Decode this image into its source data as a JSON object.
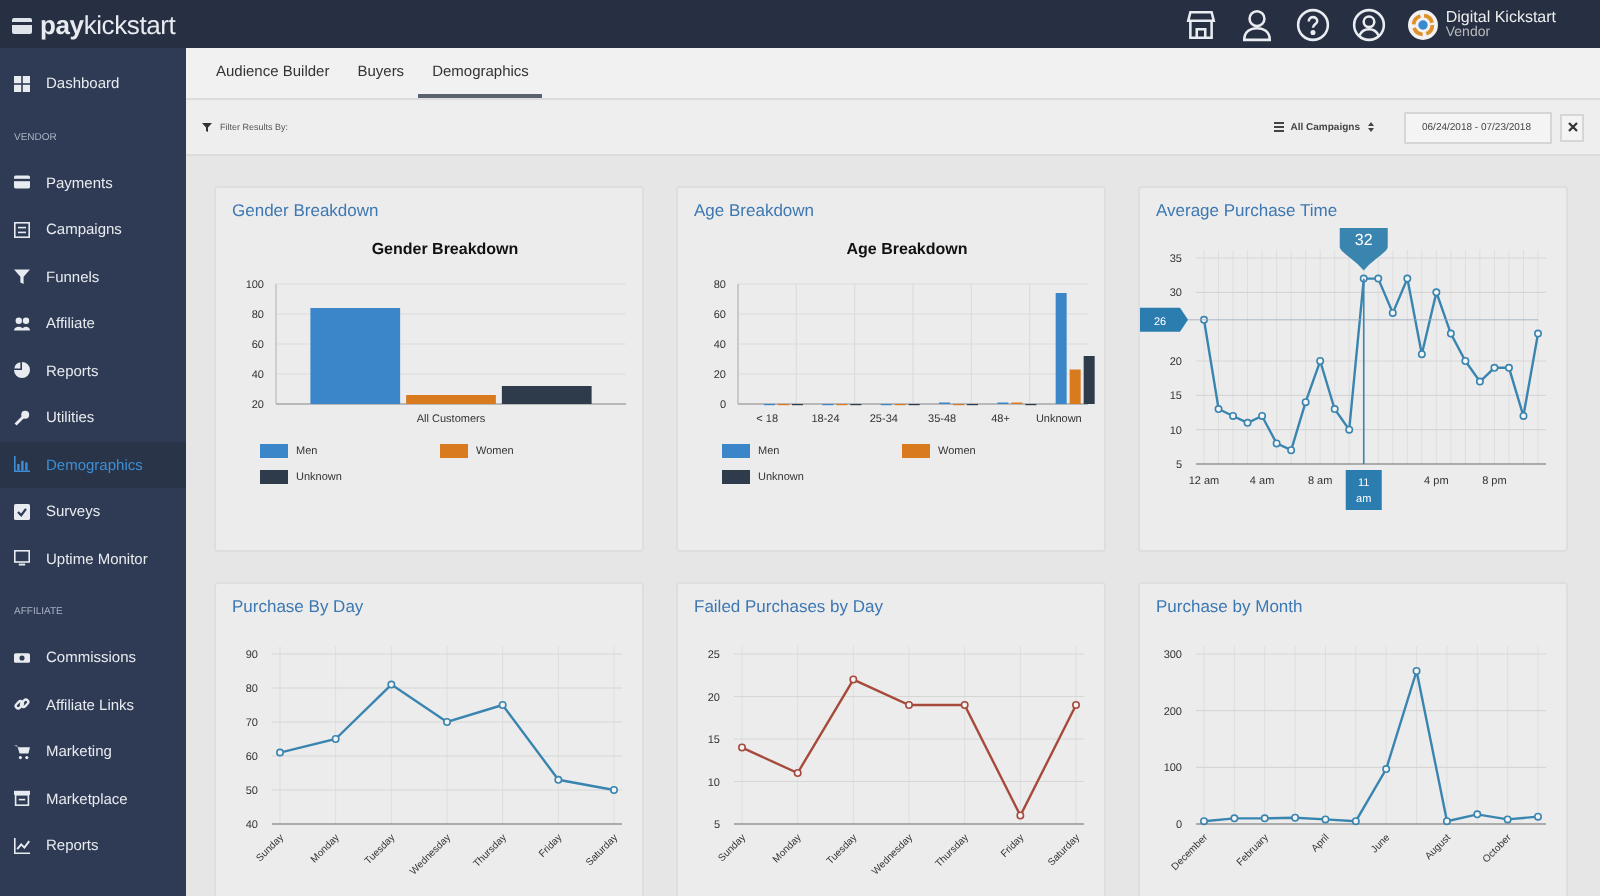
{
  "top_bar": {
    "logo": "**pay**kickstart",
    "account": {
      "name": "Digital Kickstart",
      "role": "Vendor"
    }
  },
  "sidebar": {
    "sections": [
      {
        "items": [
          {
            "label": "Dashboard",
            "selected": false
          }
        ]
      },
      {
        "heading": "VENDOR",
        "items": [
          {
            "label": "Payments",
            "selected": false
          },
          {
            "label": "Campaigns",
            "selected": false
          },
          {
            "label": "Funnels",
            "selected": false
          },
          {
            "label": "Affiliate",
            "selected": false
          },
          {
            "label": "Reports",
            "selected": false
          },
          {
            "label": "Utilities",
            "selected": false
          },
          {
            "label": "Demographics",
            "selected": true
          },
          {
            "label": "Surveys",
            "selected": false
          },
          {
            "label": "Uptime Monitor",
            "selected": false
          }
        ]
      },
      {
        "heading": "AFFILIATE",
        "items": [
          {
            "label": "Commissions",
            "selected": false
          },
          {
            "label": "Affiliate Links",
            "selected": false
          },
          {
            "label": "Marketing",
            "selected": false
          },
          {
            "label": "Marketplace",
            "selected": false
          },
          {
            "label": "Reports",
            "selected": false
          }
        ]
      }
    ]
  },
  "tabs": [
    {
      "label": "Audience Builder",
      "selected": false
    },
    {
      "label": "Buyers",
      "selected": false
    },
    {
      "label": "Demographics",
      "selected": true
    }
  ],
  "filter_bar": {
    "label": "Filter Results By:",
    "campaigns": "All Campaigns",
    "date_range": "06/24/2018 - 07/23/2018"
  },
  "cards": [
    {
      "title": "Gender Breakdown",
      "chart_data": {
        "type": "bar",
        "title": "Gender Breakdown",
        "grid": true,
        "categories": [
          "All Customers"
        ],
        "yticks": [
          20,
          40,
          60,
          80,
          100
        ],
        "ylim": [
          20,
          100
        ],
        "series": [
          {
            "name": "Men",
            "color": "#3b86c8",
            "values": [
              84
            ]
          },
          {
            "name": "Women",
            "color": "#d97a1e",
            "values": [
              26
            ]
          },
          {
            "name": "Unknown",
            "color": "#2d3b4a",
            "values": [
              32
            ]
          }
        ]
      }
    },
    {
      "title": "Age Breakdown",
      "chart_data": {
        "type": "bar",
        "title": "Age Breakdown",
        "grid": true,
        "categories": [
          "< 18",
          "18-24",
          "25-34",
          "35-48",
          "48+",
          "Unknown"
        ],
        "yticks": [
          0,
          20,
          40,
          60,
          80
        ],
        "ylim": [
          0,
          80
        ],
        "series": [
          {
            "name": "Men",
            "color": "#3b86c8",
            "values": [
              0,
              0,
              0,
              1,
              1,
              74
            ]
          },
          {
            "name": "Women",
            "color": "#d97a1e",
            "values": [
              0,
              0,
              0,
              0,
              1,
              23
            ]
          },
          {
            "name": "Unknown",
            "color": "#2d3b4a",
            "values": [
              0,
              0,
              0,
              0,
              0,
              32
            ]
          }
        ]
      }
    },
    {
      "title": "Average Purchase Time",
      "chart_data": {
        "type": "line",
        "grid": true,
        "categories": [
          "12 am",
          null,
          null,
          null,
          "4 am",
          null,
          null,
          null,
          "8 am",
          null,
          null,
          null,
          null,
          null,
          null,
          null,
          "4 pm",
          null,
          null,
          null,
          "8 pm",
          null,
          null,
          null
        ],
        "ylim": [
          5,
          35
        ],
        "yticks": [
          5,
          10,
          15,
          20,
          30,
          35
        ],
        "series": [
          {
            "color": "#3a85b0",
            "marker": "o",
            "values": [
              26,
              13,
              12,
              11,
              12,
              8,
              7,
              14,
              20,
              13,
              10,
              32,
              32,
              27,
              32,
              21,
              30,
              24,
              20,
              17,
              19,
              19,
              12,
              24
            ]
          }
        ],
        "annotations": [
          {
            "text": "32",
            "y": 32
          },
          {
            "text": "11 am"
          }
        ],
        "ref_lines": [
          {
            "axis": "y",
            "value": 26,
            "label": "26"
          }
        ]
      }
    },
    {
      "title": "Purchase By Day",
      "chart_data": {
        "type": "line",
        "grid": true,
        "categories": [
          "Sunday",
          "Monday",
          "Tuesday",
          "Wednesday",
          "Thursday",
          "Friday",
          "Saturday"
        ],
        "ylim": [
          40,
          90
        ],
        "yticks": [
          40,
          50,
          60,
          70,
          80,
          90
        ],
        "series": [
          {
            "color": "#3a85b0",
            "marker": "o",
            "values": [
              61,
              65,
              81,
              70,
              75,
              53,
              50
            ]
          }
        ]
      }
    },
    {
      "title": "Failed Purchases by Day",
      "chart_data": {
        "type": "line",
        "grid": true,
        "categories": [
          "Sunday",
          "Monday",
          "Tuesday",
          "Wednesday",
          "Thursday",
          "Friday",
          "Saturday"
        ],
        "ylim": [
          5,
          25
        ],
        "yticks": [
          5,
          10,
          15,
          20,
          25
        ],
        "series": [
          {
            "color": "#a64a3c",
            "marker": "o",
            "values": [
              14,
              11,
              22,
              19,
              19,
              6,
              19
            ]
          }
        ]
      }
    },
    {
      "title": "Purchase by Month",
      "chart_data": {
        "type": "line",
        "grid": true,
        "categories": [
          "December",
          null,
          "February",
          null,
          "April",
          null,
          "June",
          null,
          "August",
          null,
          "October",
          null
        ],
        "ylim": [
          0,
          300
        ],
        "yticks": [
          0,
          100,
          200,
          300
        ],
        "series": [
          {
            "color": "#3a85b0",
            "marker": "o",
            "values": [
              5,
              10,
              10,
              11,
              8,
              5,
              97,
              270,
              5,
              17,
              8,
              13
            ]
          }
        ]
      }
    }
  ]
}
